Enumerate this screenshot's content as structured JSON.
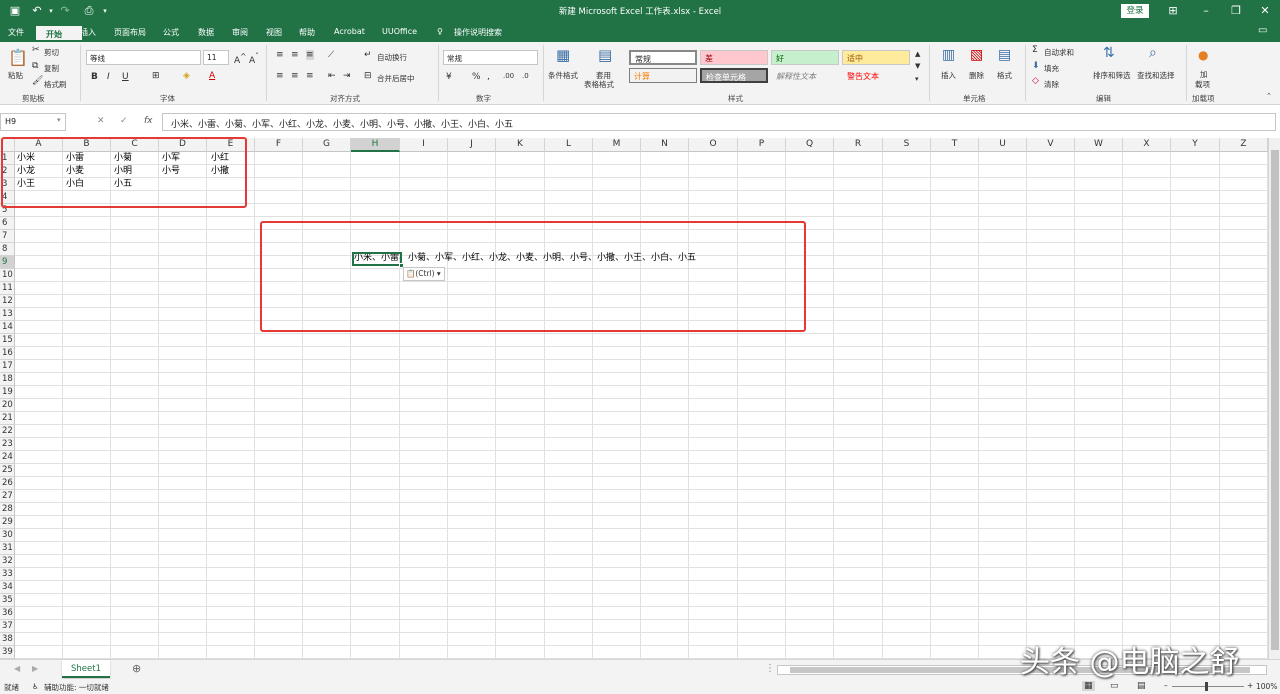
{
  "window": {
    "title": "新建 Microsoft Excel 工作表.xlsx  -  Excel",
    "login": "登录"
  },
  "menu": [
    "文件",
    "开始",
    "插入",
    "页面布局",
    "公式",
    "数据",
    "审阅",
    "视图",
    "帮助",
    "Acrobat",
    "UUOffice",
    "操作说明搜索"
  ],
  "ribbon": {
    "clipboard": {
      "paste": "粘贴",
      "cut": "剪切",
      "copy": "复制",
      "format_painter": "格式刷",
      "group": "剪贴板"
    },
    "font": {
      "name": "等线",
      "size": "11",
      "group": "字体"
    },
    "alignment": {
      "wrap": "自动换行",
      "merge": "合并后居中",
      "group": "对齐方式"
    },
    "number": {
      "format": "常规",
      "group": "数字"
    },
    "styles": {
      "conditional": "条件格式",
      "table": "套用\n表格格式",
      "normal": "常规",
      "bad": "差",
      "good": "好",
      "neutral": "适中",
      "calc": "计算",
      "check": "检查单元格",
      "explain": "解释性文本",
      "warning": "警告文本",
      "group": "样式"
    },
    "cells": {
      "insert": "插入",
      "delete": "删除",
      "format": "格式",
      "group": "单元格"
    },
    "editing": {
      "autosum": "自动求和",
      "fill": "填充",
      "clear": "清除",
      "sort": "排序和筛选",
      "find": "查找和选择",
      "group": "编辑"
    },
    "addins": {
      "label": "加\n载项",
      "group": "加载项"
    }
  },
  "formula": {
    "namebox": "H9",
    "content": "小米、小雷、小菊、小军、小红、小龙、小麦、小明、小号、小撒、小王、小白、小五"
  },
  "columns": [
    "A",
    "B",
    "C",
    "D",
    "E",
    "F",
    "G",
    "H",
    "I",
    "J",
    "K",
    "L",
    "M",
    "N",
    "O",
    "P",
    "Q",
    "R",
    "S",
    "T",
    "U",
    "V",
    "W",
    "X",
    "Y",
    "Z"
  ],
  "rows": [
    "1",
    "2",
    "3",
    "4",
    "5",
    "6",
    "7",
    "8",
    "9",
    "10",
    "11",
    "12",
    "13",
    "14",
    "15",
    "16",
    "17",
    "18",
    "19",
    "20",
    "21",
    "22",
    "23",
    "24",
    "25",
    "26",
    "27",
    "28",
    "29",
    "30",
    "31",
    "32",
    "33",
    "34",
    "35",
    "36",
    "37",
    "38",
    "39",
    "40"
  ],
  "cells": {
    "r1": [
      "小米",
      "小雷",
      "小菊",
      "小军",
      "小红"
    ],
    "r2": [
      "小龙",
      "小麦",
      "小明",
      "小号",
      "小撒"
    ],
    "r3": [
      "小王",
      "小白",
      "小五"
    ],
    "h9": "小米、小雷、小菊、小军、小红、小龙、小麦、小明、小号、小撒、小王、小白、小五"
  },
  "paste_options": "(Ctrl)",
  "sheet": {
    "tab": "Sheet1"
  },
  "status": {
    "ready": "就绪",
    "accessibility": "辅助功能: 一切就绪",
    "zoom": "100%"
  },
  "watermark": "头条 @电脑之舒"
}
